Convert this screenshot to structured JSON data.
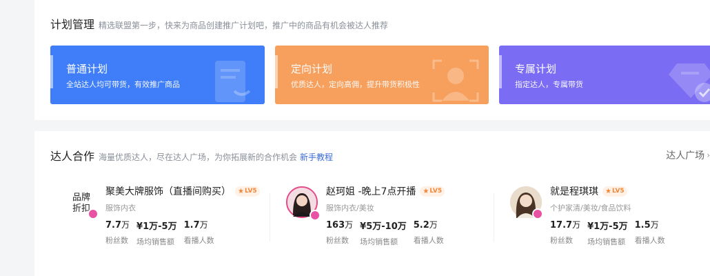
{
  "plan_section": {
    "title": "计划管理",
    "desc": "精选联盟第一步，快来为商品创建推广计划吧，推广中的商品有机会被达人推荐",
    "cards": [
      {
        "title": "普通计划",
        "subtitle": "全站达人均可带货，有效推广商品",
        "color": "#3f7ef8",
        "icon": "document-icon"
      },
      {
        "title": "定向计划",
        "subtitle": "优质达人，定向高佣，提升带货积极性",
        "color": "#f79f5c",
        "icon": "person-target-icon"
      },
      {
        "title": "专属计划",
        "subtitle": "指定达人，专属带货",
        "color": "#7a6cf3",
        "icon": "diamond-check-icon"
      }
    ]
  },
  "kol_section": {
    "title": "达人合作",
    "desc": "海量优质达人，尽在达人广场，为你拓展新的合作机会",
    "link": "新手教程",
    "more": "达人广场",
    "items": [
      {
        "name": "聚美大牌服饰（直播间购买）",
        "level": "LV5",
        "category": "服饰内衣",
        "avatar_text": "品牌折扣",
        "stats": [
          {
            "value": "7.7",
            "unit": "万",
            "label": "粉丝数"
          },
          {
            "value": "¥1万-5万",
            "unit": "",
            "label": "场均销售额"
          },
          {
            "value": "1.7",
            "unit": "万",
            "label": "看播人数"
          }
        ]
      },
      {
        "name": "赵珂姐 -晚上7点开播",
        "level": "LV5",
        "category": "服饰内衣/美妆",
        "stats": [
          {
            "value": "163",
            "unit": "万",
            "label": "粉丝数"
          },
          {
            "value": "¥5万-10万",
            "unit": "",
            "label": "场均销售额"
          },
          {
            "value": "5.2",
            "unit": "万",
            "label": "看播人数"
          }
        ]
      },
      {
        "name": "就是程琪琪",
        "level": "LV5",
        "category": "个护家清/美妆/食品饮料",
        "stats": [
          {
            "value": "17.7",
            "unit": "万",
            "label": "粉丝数"
          },
          {
            "value": "¥1万-5万",
            "unit": "",
            "label": "场均销售额"
          },
          {
            "value": "1.5",
            "unit": "万",
            "label": "看播人数"
          }
        ]
      }
    ]
  }
}
